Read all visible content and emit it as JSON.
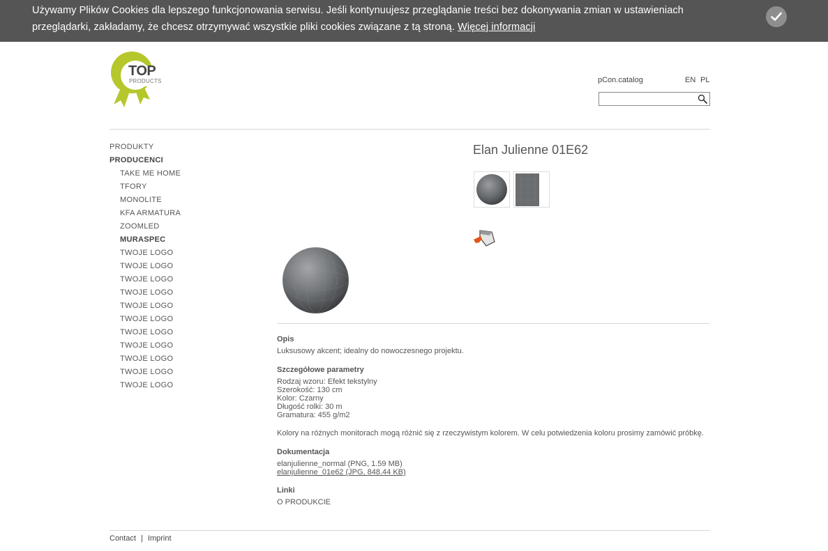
{
  "cookie": {
    "text": "Używamy Plików Cookies dla lepszego funkcjonowania serwisu. Jeśli kontynuujesz przeglądanie treści bez dokonywania zmian w ustawieniach przeglądarki, zakładamy, że chcesz otrzymywać wszystkie pliki cookies związane z tą stroną.",
    "link": "Więcej informacji",
    "accept_icon": "check-icon"
  },
  "logo": {
    "top": "TOP",
    "products": "PRODUCTS",
    "accent": "#b5c72b"
  },
  "header": {
    "pcon": "pCon.catalog",
    "lang_en": "EN",
    "lang_pl": "PL",
    "search_placeholder": "",
    "search_icon": "magnifier-icon"
  },
  "nav": {
    "produkty": "PRODUKTY",
    "producenci": "PRODUCENCI",
    "items": [
      "TAKE ME HOME",
      "TFORY",
      "MONOLITE",
      "KFA ARMATURA",
      "ZOOMLED",
      "MURASPEC",
      "TWOJE LOGO",
      "TWOJE LOGO",
      "TWOJE LOGO",
      "TWOJE LOGO",
      "TWOJE LOGO",
      "TWOJE LOGO",
      "TWOJE LOGO",
      "TWOJE LOGO",
      "TWOJE LOGO",
      "TWOJE LOGO",
      "TWOJE LOGO"
    ],
    "active": "MURASPEC"
  },
  "product": {
    "title": "Elan Julienne 01E62",
    "opis_h": "Opis",
    "opis": "Luksusowy akcent; idealny do nowoczesnego projektu.",
    "params_h": "Szczegółowe parametry",
    "params": [
      "Rodzaj wzoru: Efekt tekstylny",
      "Szerokość: 130 cm",
      "Kolor: Czarny",
      "Długość rolki: 30 m",
      "Gramatura: 455 g/m2"
    ],
    "note": "Kolory na różnych monitorach mogą różnić się z rzeczywistym kolorem. W celu potwiedzenia koloru prosimy zamówić próbkę.",
    "doc_h": "Dokumentacja",
    "docs": [
      "elanjulienne_normal (PNG, 1.59 MB)",
      "elanjulienne_01e62 (JPG, 848.44 KB)"
    ],
    "links_h": "Linki",
    "links": [
      "O PRODUKCIE"
    ]
  },
  "footer": {
    "contact": "Contact",
    "sep": "|",
    "imprint": "Imprint"
  }
}
